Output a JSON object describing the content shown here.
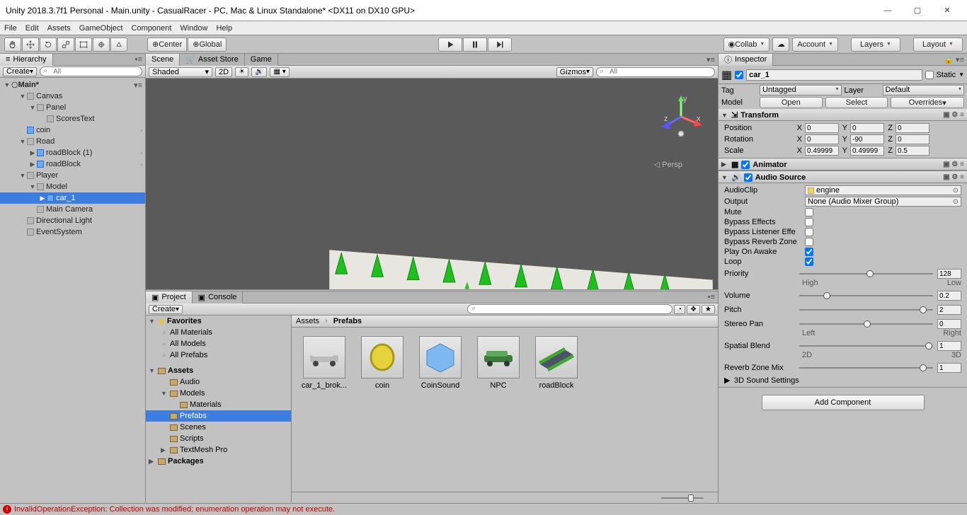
{
  "window": {
    "title": "Unity 2018.3.7f1 Personal - Main.unity - CasualRacer - PC, Mac & Linux Standalone* <DX11 on DX10 GPU>"
  },
  "menu": [
    "File",
    "Edit",
    "Assets",
    "GameObject",
    "Component",
    "Window",
    "Help"
  ],
  "toolbar": {
    "center": "Center",
    "global": "Global",
    "collab": "Collab",
    "account": "Account",
    "layers": "Layers",
    "layout": "Layout"
  },
  "hierarchy": {
    "tab": "Hierarchy",
    "create": "Create",
    "search_placeholder": "All",
    "root": "Main*",
    "items": [
      {
        "n": "Canvas",
        "d": 1,
        "exp": true
      },
      {
        "n": "Panel",
        "d": 2,
        "exp": true
      },
      {
        "n": "ScoresText",
        "d": 3
      },
      {
        "n": "coin",
        "d": 1,
        "blue": true,
        "chev": true
      },
      {
        "n": "Road",
        "d": 1,
        "exp": true
      },
      {
        "n": "roadBlock (1)",
        "d": 2,
        "blue": true,
        "chev": true,
        "col": true
      },
      {
        "n": "roadBlock",
        "d": 2,
        "blue": true,
        "chev": true,
        "col": true
      },
      {
        "n": "Player",
        "d": 1,
        "exp": true
      },
      {
        "n": "Model",
        "d": 2,
        "exp": true
      },
      {
        "n": "car_1",
        "d": 3,
        "blue": true,
        "sel": true,
        "col": true
      },
      {
        "n": "Main Camera",
        "d": 2
      },
      {
        "n": "Directional Light",
        "d": 1
      },
      {
        "n": "EventSystem",
        "d": 1
      }
    ]
  },
  "scene": {
    "tabs": [
      "Scene",
      "Asset Store",
      "Game"
    ],
    "shaded": "Shaded",
    "mode2d": "2D",
    "gizmos": "Gizmos",
    "persp": "Persp",
    "search_placeholder": "All"
  },
  "project": {
    "tabs": [
      "Project",
      "Console"
    ],
    "create": "Create",
    "breadcrumb": [
      "Assets",
      "Prefabs"
    ],
    "favorites": "Favorites",
    "fav_items": [
      "All Materials",
      "All Models",
      "All Prefabs"
    ],
    "assets": "Assets",
    "folders": [
      "Audio",
      "Models",
      "Materials",
      "Prefabs",
      "Scenes",
      "Scripts",
      "TextMesh Pro"
    ],
    "packages": "Packages",
    "items": [
      "car_1_brok...",
      "coin",
      "CoinSound",
      "NPC",
      "roadBlock"
    ]
  },
  "inspector": {
    "tab": "Inspector",
    "name": "car_1",
    "static": "Static",
    "tag_label": "Tag",
    "tag": "Untagged",
    "layer_label": "Layer",
    "layer": "Default",
    "model_label": "Model",
    "open": "Open",
    "select": "Select",
    "overrides": "Overrides",
    "transform": {
      "title": "Transform",
      "pos_label": "Position",
      "pos": {
        "x": "0",
        "y": "0",
        "z": "0"
      },
      "rot_label": "Rotation",
      "rot": {
        "x": "0",
        "y": "-90",
        "z": "0"
      },
      "scale_label": "Scale",
      "scale": {
        "x": "0.49999",
        "y": "0.49999",
        "z": "0.5"
      }
    },
    "animator": {
      "title": "Animator"
    },
    "audio": {
      "title": "Audio Source",
      "clip_label": "AudioClip",
      "clip": "engine",
      "output_label": "Output",
      "output": "None (Audio Mixer Group)",
      "mute": "Mute",
      "bypass_eff": "Bypass Effects",
      "bypass_lis": "Bypass Listener Effe",
      "bypass_rev": "Bypass Reverb Zone",
      "play_awake": "Play On Awake",
      "loop": "Loop",
      "priority": "Priority",
      "priority_v": "128",
      "priority_l": "High",
      "priority_r": "Low",
      "volume": "Volume",
      "volume_v": "0.2",
      "pitch": "Pitch",
      "pitch_v": "2",
      "stereo": "Stereo Pan",
      "stereo_v": "0",
      "stereo_l": "Left",
      "stereo_r": "Right",
      "spatial": "Spatial Blend",
      "spatial_v": "1",
      "spatial_l": "2D",
      "spatial_r": "3D",
      "reverb": "Reverb Zone Mix",
      "reverb_v": "1",
      "sound3d": "3D Sound Settings"
    },
    "add": "Add Component"
  },
  "status": {
    "error": "InvalidOperationException: Collection was modified; enumeration operation may not execute."
  }
}
